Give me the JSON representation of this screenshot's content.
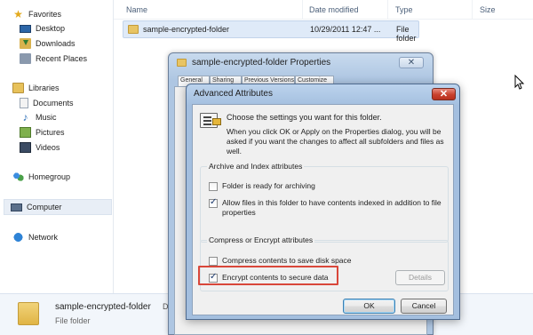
{
  "nav": {
    "favorites": "Favorites",
    "desktop": "Desktop",
    "downloads": "Downloads",
    "recent": "Recent Places",
    "libraries": "Libraries",
    "documents": "Documents",
    "music": "Music",
    "pictures": "Pictures",
    "videos": "Videos",
    "homegroup": "Homegroup",
    "computer": "Computer",
    "network": "Network"
  },
  "list": {
    "columns": {
      "name": "Name",
      "date": "Date modified",
      "type": "Type",
      "size": "Size"
    },
    "row": {
      "name": "sample-encrypted-folder",
      "date": "10/29/2011 12:47 ...",
      "type": "File folder"
    }
  },
  "details": {
    "name": "sample-encrypted-folder",
    "extra": "Da",
    "type": "File folder"
  },
  "props": {
    "title": "sample-encrypted-folder Properties",
    "close": "✕",
    "tabs": [
      "General",
      "Sharing",
      "Previous Versions",
      "Customize"
    ]
  },
  "adv": {
    "title": "Advanced Attributes",
    "close": "✕",
    "intro1": "Choose the settings you want for this folder.",
    "intro2": "When you click OK or Apply on the Properties dialog, you will be asked if you want the changes to affect all subfolders and files as well.",
    "archive_group": "Archive and Index attributes",
    "archive_label": "Folder is ready for archiving",
    "index_label": "Allow files in this folder to have contents indexed in addition to file properties",
    "compress_group": "Compress or Encrypt attributes",
    "compress_label": "Compress contents to save disk space",
    "encrypt_label": "Encrypt contents to secure data",
    "details_button": "Details",
    "ok_button": "OK",
    "cancel_button": "Cancel"
  },
  "colors": {
    "highlight": "#d9473a",
    "title_bar": "#a4bfdf"
  }
}
